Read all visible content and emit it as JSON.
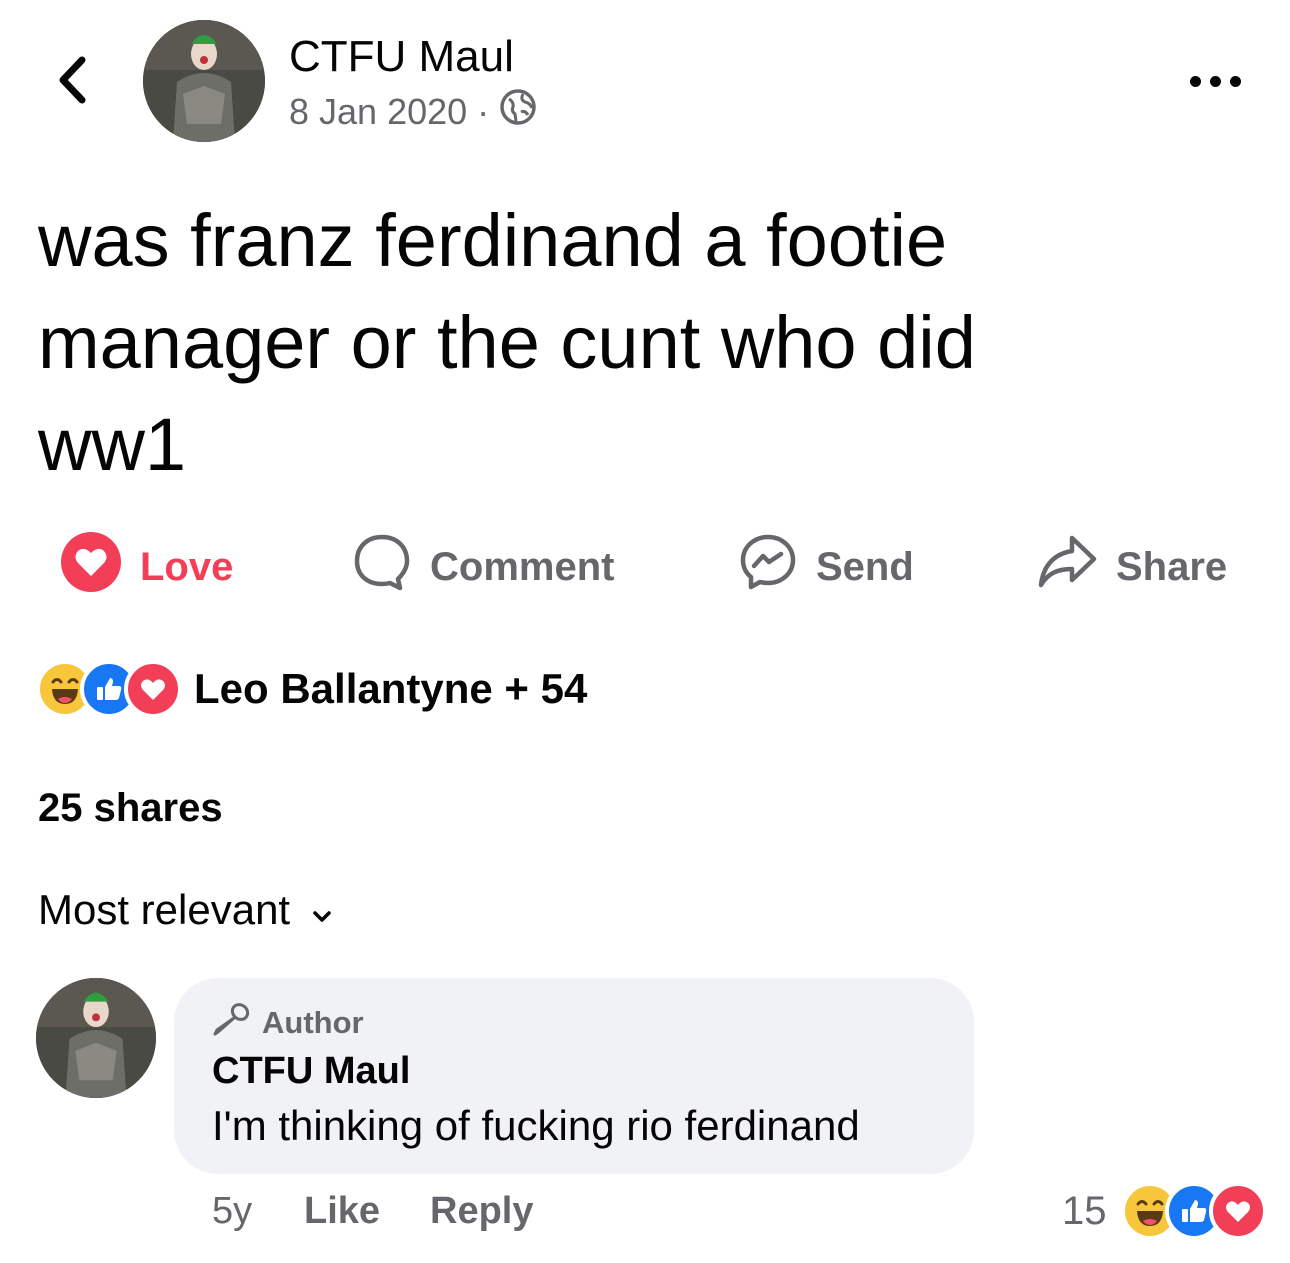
{
  "header": {
    "back_icon": "chevron-left-icon",
    "author": "CTFU Maul",
    "date": "8 Jan 2020",
    "separator": "·",
    "audience_icon": "globe-icon",
    "more_icon": "more-horizontal-icon"
  },
  "post": {
    "lines": [
      "was franz ferdinand a footie",
      "manager or the cunt who did",
      "ww1"
    ]
  },
  "actions": {
    "love": "Love",
    "comment": "Comment",
    "send": "Send",
    "share": "Share"
  },
  "reactions": {
    "types": [
      "haha",
      "like",
      "love"
    ],
    "summary": "Leo Ballantyne + 54"
  },
  "shares": "25 shares",
  "sort": {
    "label": "Most relevant",
    "icon": "chevron-down-icon"
  },
  "comment": {
    "badge": "Author",
    "badge_icon": "microphone-icon",
    "author": "CTFU Maul",
    "text": "I'm thinking of fucking rio ferdinand",
    "age": "5y",
    "like": "Like",
    "reply": "Reply",
    "reaction_count": "15",
    "reaction_types": [
      "haha",
      "like",
      "love"
    ]
  },
  "colors": {
    "love_red": "#f33e58",
    "like_blue": "#1877f2",
    "haha_yellow": "#f7c63b",
    "secondary_text": "#65676b",
    "bubble_bg": "#f0f2f5"
  }
}
